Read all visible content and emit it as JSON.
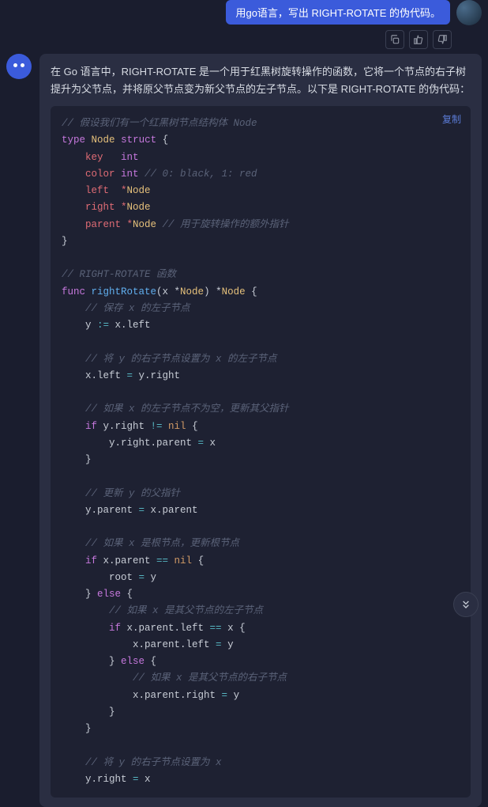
{
  "user": {
    "message": "用go语言，写出 RIGHT-ROTATE 的伪代码。"
  },
  "assistant": {
    "intro": "在 Go 语言中，RIGHT-ROTATE 是一个用于红黑树旋转操作的函数，它将一个节点的右子树提升为父节点，并将原父节点变为新父节点的左子节点。以下是 RIGHT-ROTATE 的伪代码：",
    "copy_label": "复制",
    "code": {
      "c1": "// 假设我们有一个红黑树节点结构体 Node",
      "l2_kw_type": "type",
      "l2_name": "Node",
      "l2_kw_struct": "struct",
      "l2_brace": " {",
      "l3_field": "    key   ",
      "l3_type": "int",
      "l4_field": "    color ",
      "l4_type": "int",
      "l4_comment": " // 0: black, 1: red",
      "l5_field": "    left  *",
      "l5_type": "Node",
      "l6_field": "    right *",
      "l6_type": "Node",
      "l7_field": "    parent *",
      "l7_type": "Node",
      "l7_comment": " // 用于旋转操作的额外指针",
      "l8": "}",
      "c2": "// RIGHT-ROTATE 函数",
      "f_kw": "func",
      "f_name": " rightRotate",
      "f_sig1": "(x *",
      "f_sig_t1": "Node",
      "f_sig2": ") *",
      "f_sig_t2": "Node",
      "f_sig3": " {",
      "c3": "    // 保存 x 的左子节点",
      "b1a": "    y ",
      "b1op": ":=",
      "b1b": " x.left",
      "c4": "    // 将 y 的右子节点设置为 x 的左子节点",
      "b2a": "    x.left ",
      "b2op": "=",
      "b2b": " y.right",
      "c5": "    // 如果 x 的左子节点不为空，更新其父指针",
      "b3_if": "    if",
      "b3a": " y.right ",
      "b3op": "!=",
      "b3_nil": " nil",
      "b3b": " {",
      "b4a": "        y.right.parent ",
      "b4op": "=",
      "b4b": " x",
      "b5": "    }",
      "c6": "    // 更新 y 的父指针",
      "b6a": "    y.parent ",
      "b6op": "=",
      "b6b": " x.parent",
      "c7": "    // 如果 x 是根节点，更新根节点",
      "b7_if": "    if",
      "b7a": " x.parent ",
      "b7op": "==",
      "b7_nil": " nil",
      "b7b": " {",
      "b8a": "        root ",
      "b8op": "=",
      "b8b": " y",
      "b9a": "    } ",
      "b9_else": "else",
      "b9b": " {",
      "c8": "        // 如果 x 是其父节点的左子节点",
      "b10_if": "        if",
      "b10a": " x.parent.left ",
      "b10op": "==",
      "b10b": " x {",
      "b11a": "            x.parent.left ",
      "b11op": "=",
      "b11b": " y",
      "b12a": "        } ",
      "b12_else": "else",
      "b12b": " {",
      "c9": "            // 如果 x 是其父节点的右子节点",
      "b13a": "            x.parent.right ",
      "b13op": "=",
      "b13b": " y",
      "b14": "        }",
      "b15": "    }",
      "c10": "    // 将 y 的右子节点设置为 x",
      "b16a": "    y.right ",
      "b16op": "=",
      "b16b": " x"
    }
  }
}
